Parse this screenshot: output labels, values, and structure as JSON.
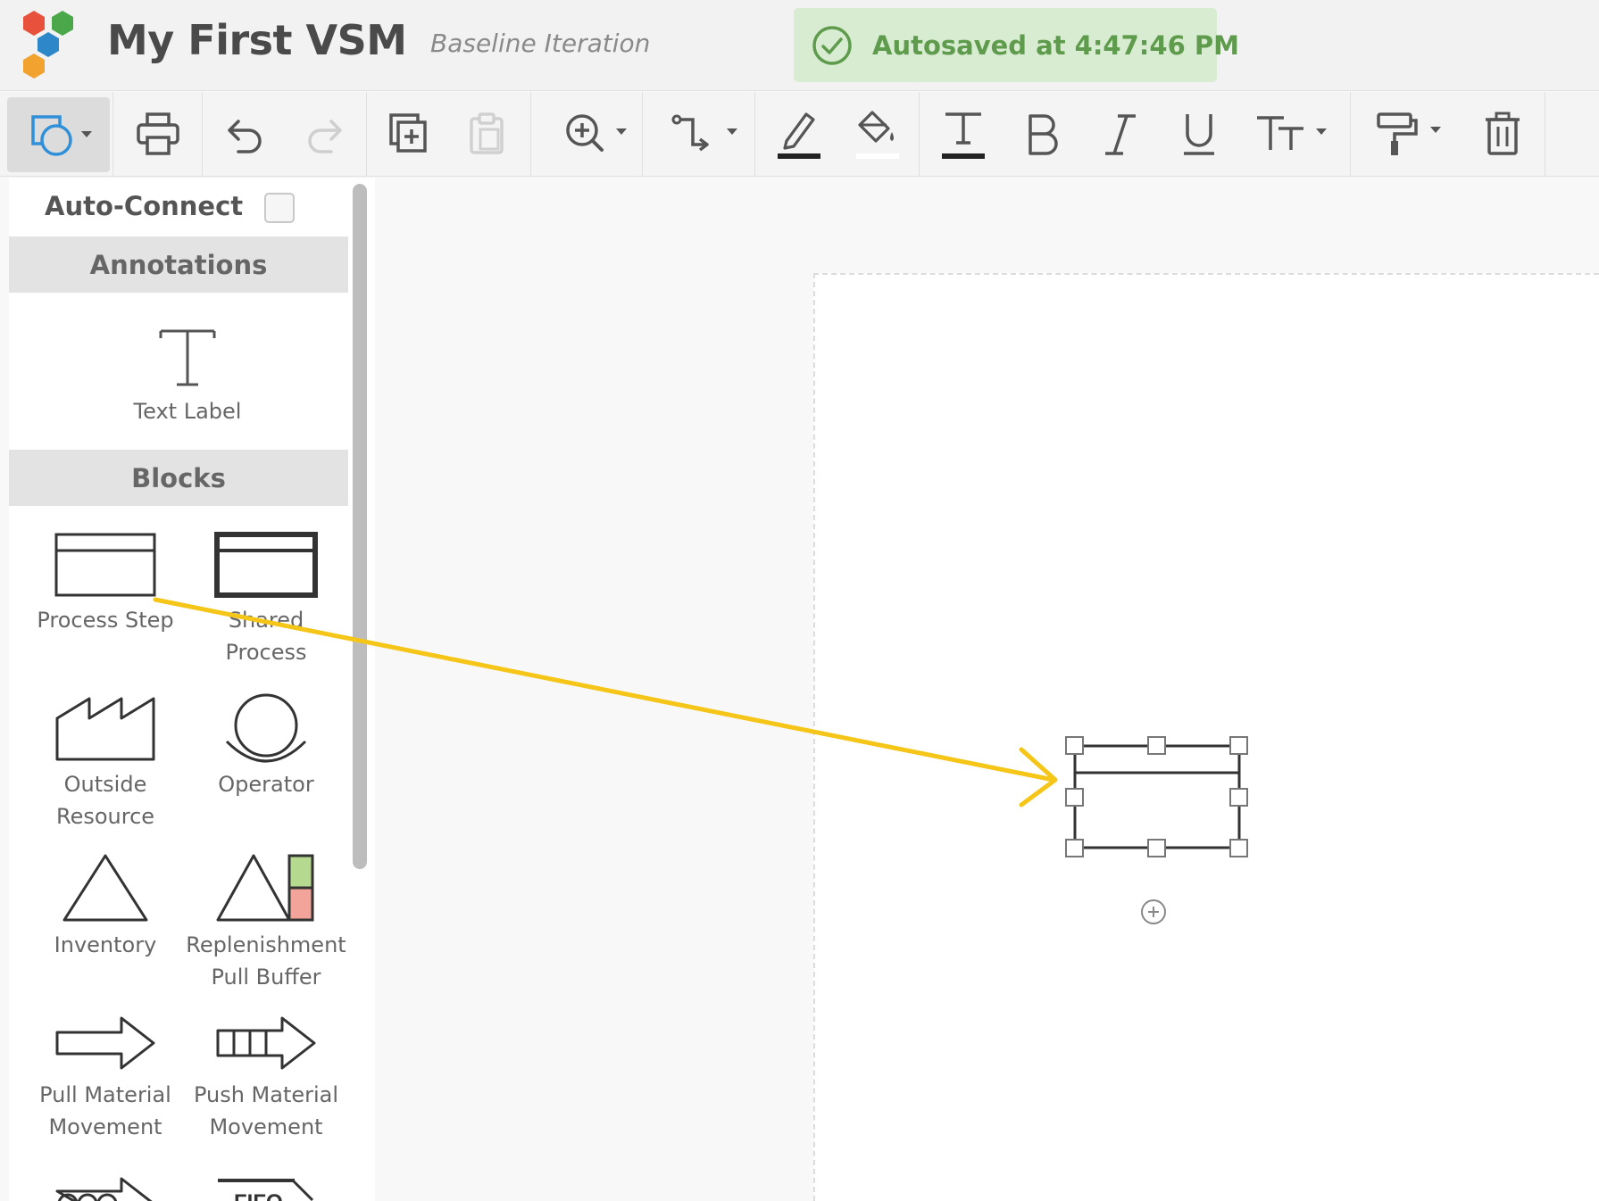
{
  "header": {
    "title": "My First VSM",
    "subtitle": "Baseline Iteration",
    "autosave_text": "Autosaved at 4:47:46 PM",
    "logo_colors": [
      "#e8513c",
      "#4aa84a",
      "#2e87c8",
      "#f2a22e"
    ]
  },
  "toolbar": {
    "buttons": [
      "shapes-menu",
      "print",
      "undo",
      "redo",
      "duplicate",
      "paste",
      "zoom-menu",
      "connector-menu",
      "line-color",
      "fill-color",
      "text-color",
      "bold",
      "italic",
      "underline",
      "text-size-menu",
      "format-painter-menu",
      "delete"
    ]
  },
  "palette": {
    "auto_connect_label": "Auto-Connect",
    "auto_connect_checked": false,
    "sections": {
      "annotations": {
        "title": "Annotations",
        "items": [
          "Text Label"
        ]
      },
      "blocks": {
        "title": "Blocks",
        "items": {
          "process_step": "Process Step",
          "shared_process": "Shared Process",
          "outside_resource": "Outside Resource",
          "operator": "Operator",
          "inventory": "Inventory",
          "replenishment_pull_buffer": "Replenishment Pull Buffer",
          "pull_material_movement": "Pull Material Movement",
          "push_material_movement": "Push Material Movement",
          "fifo_label": "FIFO"
        }
      }
    }
  },
  "colors": {
    "accent_arrow": "#f5c518",
    "autosave_bg": "#d8ecd2",
    "autosave_text": "#5f9b4c",
    "buffer_green": "#b5d98f",
    "buffer_red": "#f2a39a"
  }
}
